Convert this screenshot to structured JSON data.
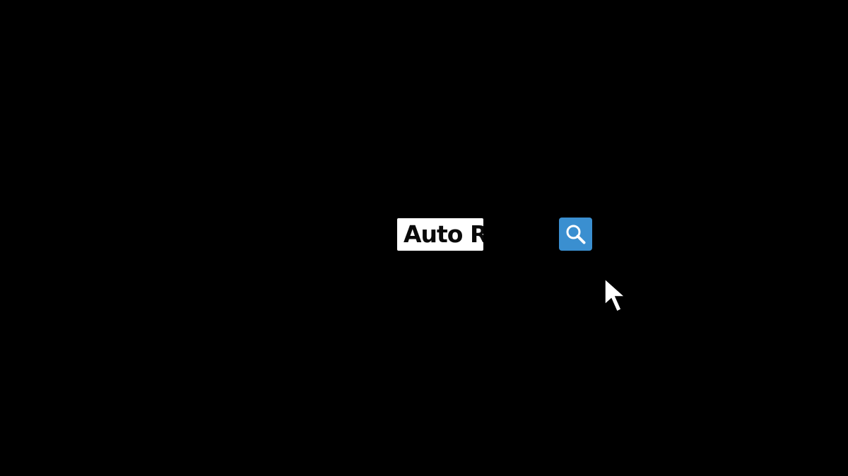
{
  "search": {
    "value": "Auto R",
    "button_icon": "search-icon",
    "button_color": "#3a8fd0"
  },
  "pointer": {
    "icon": "mouse-cursor-icon"
  }
}
